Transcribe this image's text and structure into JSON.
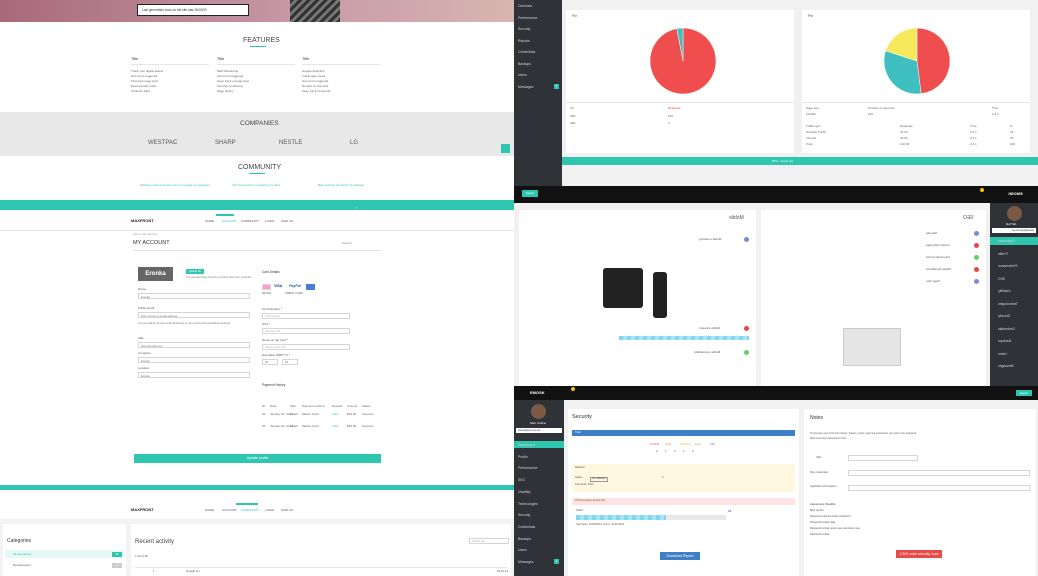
{
  "banner": {
    "text": "Last generation scan on the site was 30/09/11"
  },
  "features": {
    "title": "FEATURES",
    "columns": [
      {
        "title": "Title",
        "items": [
          "Track your digital assets",
          "Get errors triggered",
          "Find slow page load",
          "Detect broken links",
          "Optimize SEO",
          ""
        ]
      },
      {
        "title": "Title",
        "items": [
          "SEO Monitoring",
          "Get errors triggered",
          "Keep track of page load",
          "Security monitoring",
          "Page history",
          ""
        ]
      },
      {
        "title": "Title",
        "items": [
          "Google Analytics",
          "Track page views",
          "Get errors triggered",
          "Number of requests",
          "Keep track of security",
          ""
        ]
      }
    ]
  },
  "companies": {
    "title": "COMPANIES",
    "names": [
      "WESTPAC",
      "SHARP",
      "NESTLE",
      "LG"
    ]
  },
  "community": {
    "title": "COMMUNITY",
    "quotes": [
      "Website is the best site ever to manage my websites",
      "The best tool for monitoring my sites",
      "Best security check for my website"
    ]
  },
  "nav": {
    "logo": "MAXFRONT",
    "items": [
      "HOME",
      "ACCOUNT",
      "COMMUNITY",
      "LOGIN",
      "SIGN UP"
    ],
    "social": [
      "f",
      "t",
      "g",
      "in"
    ]
  },
  "account": {
    "breadcrumb": "Home / My account",
    "title": "MY ACCOUNT",
    "search_placeholder": "Search",
    "company_logo": "Eronka",
    "upload_button": "Upload file",
    "upload_hint": "You can also drag and drop a picture from your computer",
    "labels": {
      "name": "Name",
      "email": "Public email",
      "url": "URL",
      "company": "Company",
      "location": "Location"
    },
    "values": {
      "name": "Eronka",
      "email": "Don't show my email address",
      "url": "http://eronka.com",
      "company": "Eronka",
      "location": "Eronka"
    },
    "email_hint": "You can add or remove email addresses in your personal email address settings",
    "card_details": "Card Details",
    "card_type_label": "Card type",
    "card_brands": [
      "MC",
      "VISA",
      "PayPal",
      "AMEX"
    ],
    "card_options": [
      "PAYPAL",
      "CREDIT CARD"
    ],
    "card_number_label": "Card Number *",
    "card_number_placeholder": "Card number",
    "cvc_label": "CVC *",
    "cvc_placeholder": "Security code",
    "name_card_label": "Name on the card *",
    "name_card_placeholder": "Name on the card",
    "expiry_label": "Expiration (MM/YY) *",
    "expiry_month": "01",
    "expiry_year": "15",
    "payment_history": "Payment History",
    "payment_headers": [
      "ID",
      "Date",
      "Plan",
      "Payment method",
      "Receipt",
      "Amount",
      "Status"
    ],
    "payments": [
      [
        "01",
        "January 01, 2014",
        "Small",
        "Master Card",
        "View",
        "$30.00",
        "Success"
      ],
      [
        "02",
        "January 01, 2014",
        "Small",
        "Master Card",
        "View",
        "$30.00",
        "Success"
      ]
    ],
    "update_button": "Update profile"
  },
  "activity": {
    "categories_title": "Categories",
    "categories": [
      {
        "name": "All categories",
        "count": "36"
      },
      {
        "name": "Development",
        "count": "12"
      }
    ],
    "recent_title": "Recent activity",
    "search_placeholder": "Search text",
    "filter": "1-20 of 48",
    "row": {
      "no": "1",
      "site": "Google Inc.",
      "date": "03.10.14"
    }
  },
  "dashboard_top": {
    "sidebar": [
      "Overview",
      "Performance",
      "Security",
      "Reports",
      "Credentials",
      "Backups",
      "Users",
      "Messages"
    ],
    "messages_badge": "5",
    "pie1": {
      "title": "Pie",
      "headers": [
        "Url",
        "Requests"
      ],
      "rows": [
        [
          "URL",
          "120"
        ],
        [
          "URL",
          "4"
        ]
      ]
    },
    "pie2": {
      "title": "Pie",
      "headers": [
        "Page size",
        "Number of requests",
        "Time"
      ],
      "rows": [
        [
          "1024kb",
          "120",
          "2.3 s"
        ]
      ],
      "headers2": [
        "Traffic type",
        "Requests",
        "Time",
        "%"
      ],
      "rows2": [
        [
          "Network Traffic",
          "32.00",
          "2.3 s",
          "75"
        ],
        [
          "Internal",
          "20.00",
          "2.3 s",
          "25"
        ],
        [
          "Total",
          "120.00",
          "2.3 s",
          "100"
        ]
      ]
    },
    "status_bar": "95% - Good (A)"
  },
  "chart_data": [
    {
      "type": "pie",
      "title": "Pie",
      "values": [
        97,
        3
      ],
      "colors": [
        "#f04e4e",
        "#3fbfbf"
      ]
    },
    {
      "type": "pie",
      "title": "Pie",
      "values": [
        48,
        32,
        20
      ],
      "colors": [
        "#f04e4e",
        "#3fbfbf",
        "#f4ea5b"
      ]
    }
  ],
  "seo_panel": {
    "logo": "EMOSK",
    "user": "Jeff Sull",
    "url_input": "www.bigcorp.com.au",
    "sidebar": [
      "Dashboard",
      "Profile",
      "Performance",
      "SEO",
      "Usability",
      "Technologies",
      "Security",
      "Credentials",
      "Backups",
      "Users",
      "Messages"
    ],
    "seo_title": "SEO",
    "seo_items": [
      "Sitemap",
      "Custom 404 page",
      "Canonicals Found",
      "Mobile friendliness",
      "Page Size"
    ],
    "mobile_title": "Mobile",
    "mobile_items": [
      "Mobile rendering",
      "Mobile viewport",
      "Mobile compatibility"
    ],
    "button": "Export"
  },
  "security": {
    "logo": "EMOSK",
    "user": "Sam Collins",
    "url_input": "www.bigcorp.com.au",
    "sidebar": [
      "Dashboard",
      "Profile",
      "Performance",
      "SEO",
      "Usability",
      "Technologies",
      "Security",
      "Credentials",
      "Backups",
      "Users",
      "Messages"
    ],
    "messages_badge": "5",
    "title": "Security",
    "bar_label": "Total",
    "levels": [
      "Critical",
      "High",
      "Medium",
      "Low",
      "Info"
    ],
    "level_counts": [
      "0",
      "1",
      "0",
      "1",
      "2"
    ],
    "scan_label": "Malware",
    "status_label": "Status",
    "status_value": "No malware",
    "status_count": "0",
    "scan_date": "Last Scan: Date",
    "phish_title": "Phish Heading default title",
    "phish_status": "Status",
    "phish_value": "63",
    "phish_last": "Last Scan: 01/30/2014, Since: 11.03.2014",
    "download_button": "Download Report",
    "top_button": "Export"
  },
  "notes": {
    "title": "Notes",
    "intro": "To increase your trust from clients, finance, hosts, payment processors you want to be protected",
    "intro2": "Start a security assessment now",
    "url_label": "URL",
    "credentials_label": "Site credentials",
    "description_label": "Application Description",
    "assessment_label": "Assessment Checklist",
    "checks": [
      "Brief checks",
      "Password manual include characters",
      "Password include data",
      "Password include upper case and lower case",
      "Password include"
    ],
    "button": "1,000 order security scan"
  }
}
